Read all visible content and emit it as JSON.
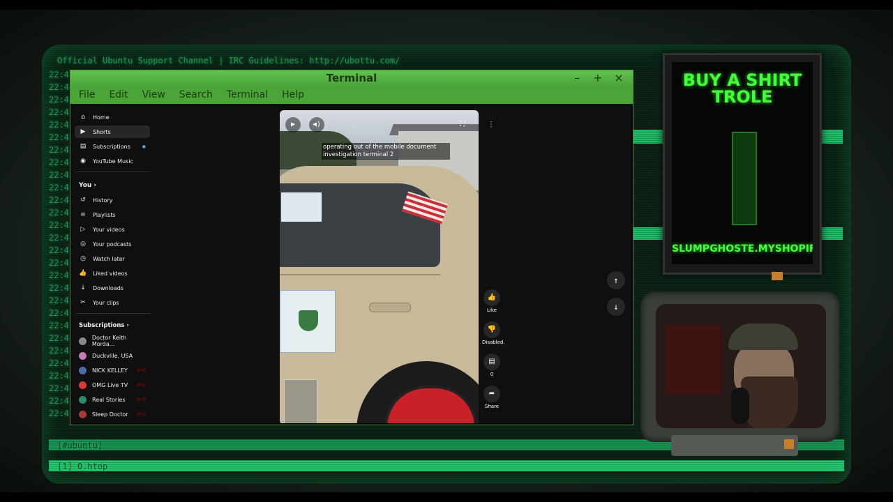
{
  "terminal": {
    "title": "Terminal",
    "menu": [
      "File",
      "Edit",
      "View",
      "Search",
      "Terminal",
      "Help"
    ],
    "controls": {
      "minimize": "–",
      "maximize": "+",
      "close": "×"
    }
  },
  "sidebar": {
    "primary": [
      {
        "label": "Home",
        "icon": "⌂"
      },
      {
        "label": "Shorts",
        "icon": "▶"
      },
      {
        "label": "Subscriptions",
        "icon": "▤"
      },
      {
        "label": "YouTube Music",
        "icon": "◉"
      }
    ],
    "you_header": "You",
    "you_items": [
      {
        "label": "History",
        "icon": "↺"
      },
      {
        "label": "Playlists",
        "icon": "≡"
      },
      {
        "label": "Your videos",
        "icon": "▷"
      },
      {
        "label": "Your podcasts",
        "icon": "◎"
      },
      {
        "label": "Watch later",
        "icon": "◷"
      },
      {
        "label": "Liked videos",
        "icon": "👍"
      },
      {
        "label": "Downloads",
        "icon": "↓"
      },
      {
        "label": "Your clips",
        "icon": "✂"
      }
    ],
    "subs_header": "Subscriptions",
    "subscriptions": [
      {
        "label": "Doctor Keith Morda...",
        "color": "#8a8a8a"
      },
      {
        "label": "Duckville, USA",
        "color": "#c77bb3"
      },
      {
        "label": "NICK KELLEY",
        "color": "#4a6aa8"
      },
      {
        "label": "OMG Live TV",
        "color": "#d83a3a"
      },
      {
        "label": "Real Stories",
        "color": "#2e8a6a"
      },
      {
        "label": "Sleep Doctor",
        "color": "#a83a3a"
      }
    ]
  },
  "video": {
    "caption": "operating out of the mobile document investigation terminal 2"
  },
  "actions": {
    "like": "Like",
    "dislike": "Disabled.",
    "comments": "0",
    "share": "Share"
  },
  "poster": {
    "title": "BUY A SHIRT TROLE",
    "url": "SLUMPGHOSTE.MYSHOPIFY.COM"
  },
  "crt_text": {
    "topic": "Official Ubuntu Support Channel | IRC Guidelines: http://ubottu.com/",
    "status": "[#ubuntu]",
    "bottom": "[1] 0.htop"
  }
}
